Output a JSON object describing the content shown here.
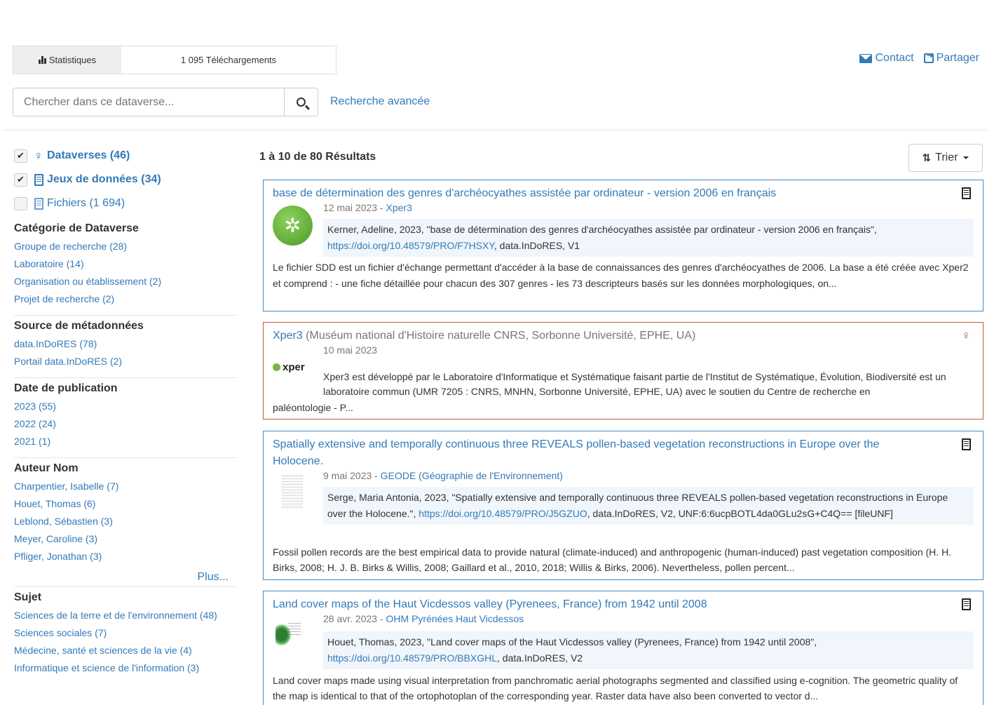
{
  "header": {
    "stats_tab": "Statistiques",
    "downloads": "1 095 Téléchargements",
    "contact": "Contact",
    "share": "Partager"
  },
  "search": {
    "placeholder": "Chercher dans ce dataverse...",
    "advanced": "Recherche avancée"
  },
  "sidebar": {
    "types": [
      {
        "label": "Dataverses (46)",
        "checked": true
      },
      {
        "label": "Jeux de données (34)",
        "checked": true
      },
      {
        "label": "Fichiers (1 694)",
        "checked": false
      }
    ],
    "facets": [
      {
        "title": "Catégorie de Dataverse",
        "items": [
          "Groupe de recherche (28)",
          "Laboratoire (14)",
          "Organisation ou établissement (2)",
          "Projet de recherche (2)"
        ]
      },
      {
        "title": "Source de métadonnées",
        "items": [
          "data.InDoRES (78)",
          "Portail data.InDoRES (2)"
        ]
      },
      {
        "title": "Date de publication",
        "items": [
          "2023 (55)",
          "2022 (24)",
          "2021 (1)"
        ]
      },
      {
        "title": "Auteur Nom",
        "items": [
          "Charpentier, Isabelle (7)",
          "Houet, Thomas (6)",
          "Leblond, Sébastien (3)",
          "Meyer, Caroline (3)",
          "Pfliger, Jonathan (3)"
        ]
      },
      {
        "title": "Sujet",
        "items": [
          "Sciences de la terre et de l'environnement (48)",
          "Sciences sociales (7)",
          "Médecine, santé et sciences de la vie (4)",
          "Informatique et science de l'information (3)"
        ]
      }
    ],
    "more": "Plus..."
  },
  "results": {
    "count": "1 à 10 de 80 Résultats",
    "sort": "Trier",
    "items": [
      {
        "title": "base de détermination des genres d'archéocyathes assistée par ordinateur - version 2006 en français",
        "date": "12 mai 2023 - ",
        "parent": "Xper3",
        "citation_text": "Kerner, Adeline, 2023, \"base de détermination des genres d'archéocyathes assistée par ordinateur - version 2006 en français\",",
        "citation_doi": "https://doi.org/10.48579/PRO/F7HSXY",
        "citation_rest": ", data.InDoRES, V1",
        "description": "Le fichier SDD est un fichier d'échange permettant d'accéder à la base de connaissances des genres d'archéocyathes de 2006. La base a été créée avec Xper2 et comprend : - une fiche détaillée pour chacun des 307 genres - les 73 descripteurs basés sur les données morphologiques, on..."
      },
      {
        "title": "Xper3",
        "affiliation": "(Muséum national d'Histoire naturelle CNRS, Sorbonne Université, EPHE, UA)",
        "date": "10 mai 2023",
        "logo": "xper",
        "description_a": "Xper3 est développé par le Laboratoire d'Informatique et Systématique faisant partie de l'Institut de Systématique, Évolution, Biodiversité est un laboratoire commun (UMR 7205 : CNRS, MNHN, Sorbonne Université, EPHE, UA) avec le soutien du Centre de recherche en",
        "description_b": "paléontologie - P..."
      },
      {
        "title_line1": "Spatially extensive and temporally continuous three REVEALS pollen-based vegetation reconstructions in Europe over the",
        "title_line2": "Holocene.",
        "date": "9 mai 2023 - ",
        "parent": "GEODE (Géographie de l'Environnement)",
        "citation_text": "Serge, Maria Antonia, 2023, \"Spatially extensive and temporally continuous three REVEALS pollen-based vegetation reconstructions in Europe over the Holocene.\", ",
        "citation_doi": "https://doi.org/10.48579/PRO/J5GZUO",
        "citation_rest": ", data.InDoRES, V2, UNF:6:6ucpBOTL4da0GLu2sG+C4Q== [fileUNF]",
        "description": "Fossil pollen records are the best empirical data to provide natural (climate-induced) and anthropogenic (human-induced) past vegetation composition (H. H. Birks, 2008; H. J. B. Birks & Willis, 2008; Gaillard et al., 2010, 2018; Willis & Birks, 2006). Nevertheless, pollen percent..."
      },
      {
        "title": "Land cover maps of the Haut Vicdessos valley (Pyrenees, France) from 1942 until 2008",
        "date": "28 avr. 2023 - ",
        "parent": "OHM Pyrénées Haut Vicdessos",
        "citation_text": "Houet, Thomas, 2023, \"Land cover maps of the Haut Vicdessos valley (Pyrenees, France) from 1942 until 2008\",",
        "citation_doi": "https://doi.org/10.48579/PRO/BBXGHL",
        "citation_rest": ", data.InDoRES, V2",
        "description": "Land cover maps made using visual interpretation from panchromatic aerial photographs segmented and classified using e-cognition. The geometric quality of the map is identical to that of the ortophotoplan of the corresponding year. Raster data have also been converted to vector d..."
      }
    ]
  },
  "colors": {
    "link": "#337ab7",
    "dataset_border": "#428bca",
    "dataverse_border": "#c55b28"
  }
}
